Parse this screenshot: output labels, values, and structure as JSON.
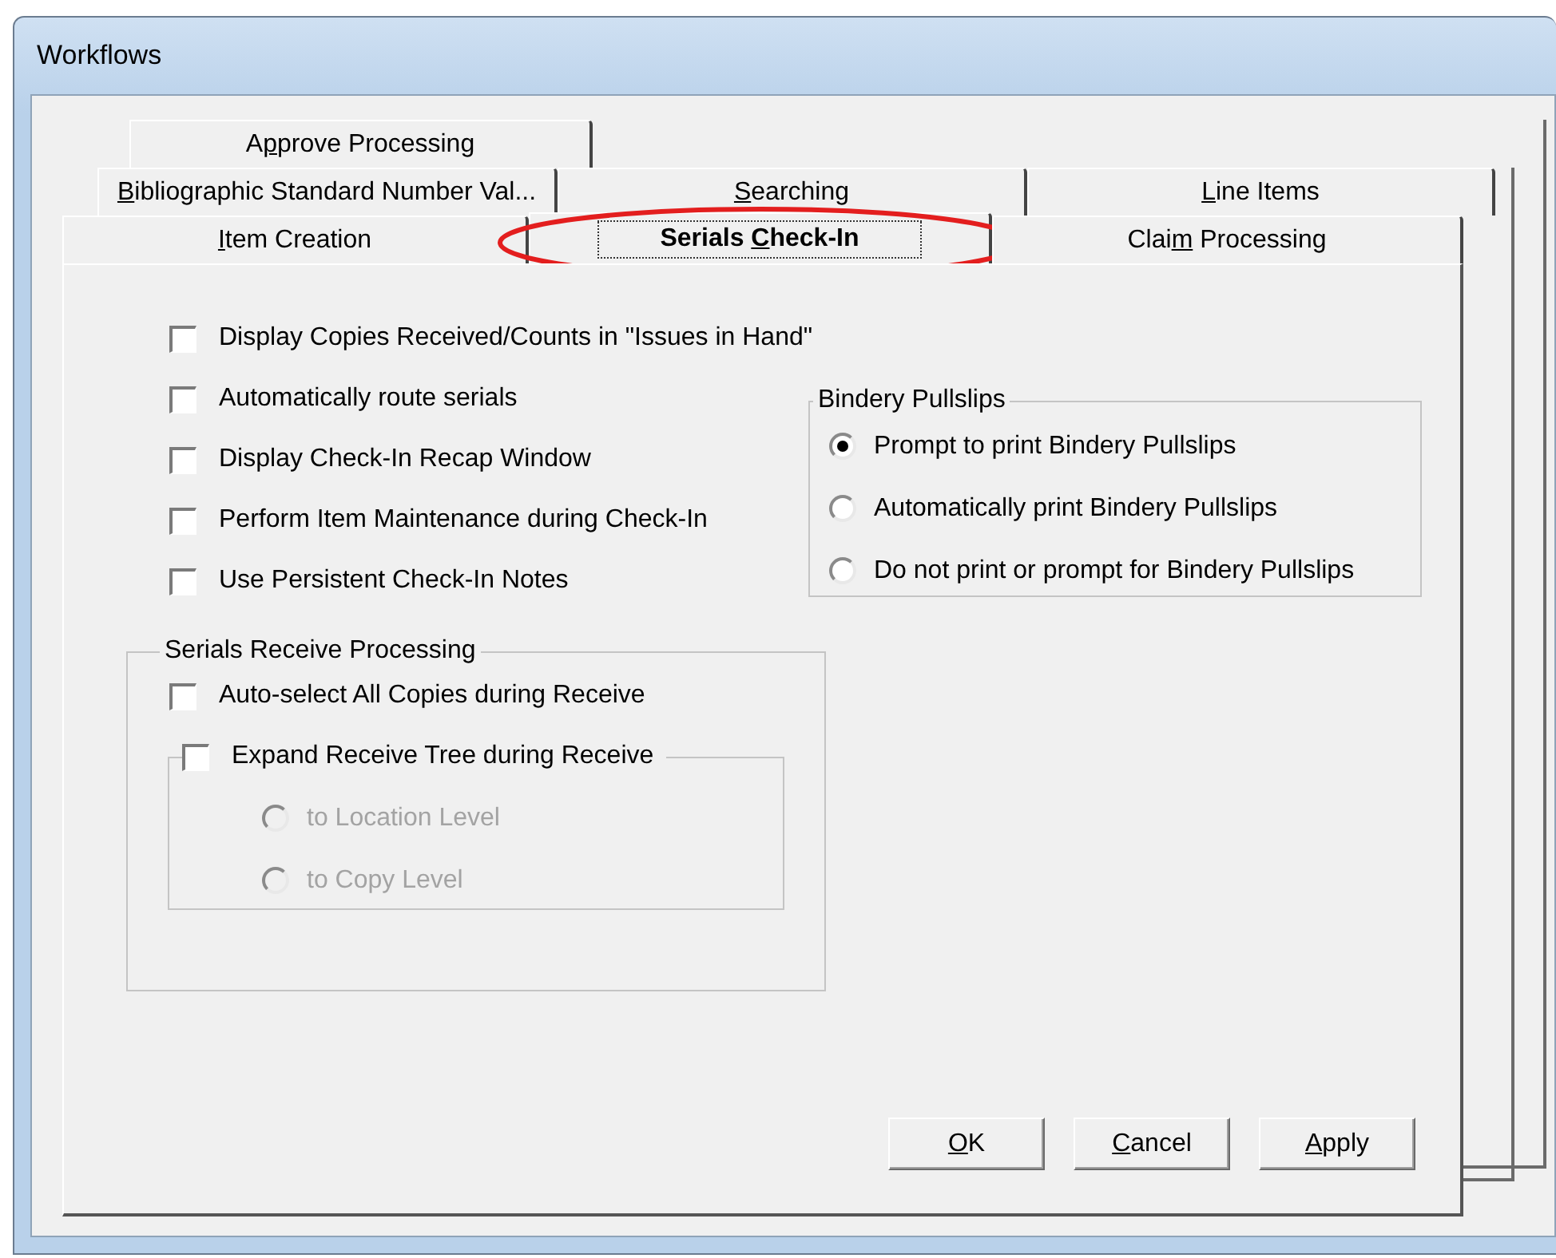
{
  "window": {
    "title": "Workflows"
  },
  "tab_rows": [
    [
      {
        "label_parts": {
          "before": "A",
          "key": "p",
          "after": "prove Processing"
        },
        "selected": false,
        "circled": false
      }
    ],
    [
      {
        "label_parts": {
          "key": "B",
          "after": "ibliographic Standard Number Val..."
        },
        "selected": false,
        "circled": false
      },
      {
        "label_parts": {
          "key": "S",
          "after": "earching"
        },
        "selected": false,
        "circled": false
      },
      {
        "label_parts": {
          "key": "L",
          "after": "ine Items"
        },
        "selected": false,
        "circled": false
      }
    ],
    [
      {
        "label_parts": {
          "key": "I",
          "after": "tem Creation"
        },
        "selected": false,
        "circled": false
      },
      {
        "label_parts": {
          "before": "Serials ",
          "key": "C",
          "after": "heck-In"
        },
        "selected": true,
        "circled": true
      },
      {
        "label_parts": {
          "before": "Clai",
          "key": "m",
          "after": " Processing"
        },
        "selected": false,
        "circled": false
      }
    ]
  ],
  "options": [
    {
      "label": "Display Copies Received/Counts in \"Issues in Hand\"",
      "checked": false
    },
    {
      "label": "Automatically route serials",
      "checked": false
    },
    {
      "label": "Display Check-In Recap Window",
      "checked": false
    },
    {
      "label": "Perform Item Maintenance during Check-In",
      "checked": false
    },
    {
      "label": "Use Persistent Check-In Notes",
      "checked": false
    }
  ],
  "bindery_pullslips": {
    "title": "Bindery Pullslips",
    "choices": [
      {
        "label": "Prompt to print Bindery Pullslips",
        "selected": true,
        "disabled": false
      },
      {
        "label": "Automatically print Bindery Pullslips",
        "selected": false,
        "disabled": false
      },
      {
        "label": "Do not print or prompt for Bindery Pullslips",
        "selected": false,
        "disabled": false
      }
    ]
  },
  "serials_receive_processing": {
    "title": "Serials Receive Processing",
    "auto_select": {
      "label": "Auto-select All Copies during Receive",
      "checked": false
    },
    "expand_tree": {
      "label": "Expand Receive Tree during Receive",
      "checked": false,
      "choices": [
        {
          "label": "to Location Level",
          "selected": false,
          "disabled": true
        },
        {
          "label": "to Copy Level",
          "selected": false,
          "disabled": true
        }
      ]
    }
  },
  "buttons": [
    {
      "label_parts": {
        "key": "O",
        "after": "K"
      }
    },
    {
      "label_parts": {
        "key": "C",
        "after": "ancel"
      }
    },
    {
      "label_parts": {
        "key": "A",
        "after": "pply"
      }
    }
  ]
}
